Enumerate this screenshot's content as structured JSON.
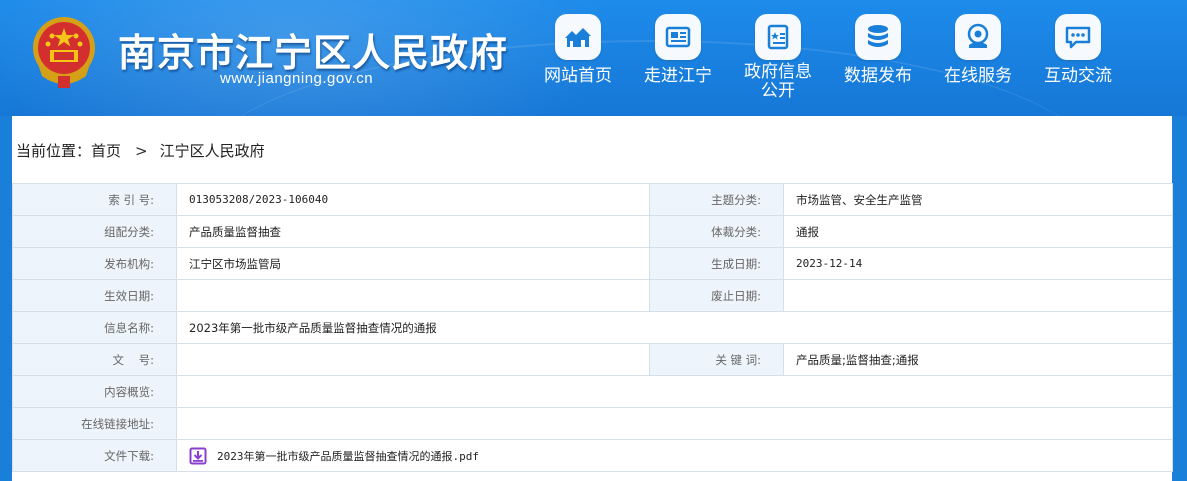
{
  "header": {
    "site_title": "南京市江宁区人民政府",
    "site_url": "www.jiangning.gov.cn",
    "nav": [
      {
        "label": "网站首页",
        "icon": "home-icon"
      },
      {
        "label": "走进江宁",
        "icon": "newspaper-icon"
      },
      {
        "label": "政府信息公开",
        "label_line1": "政府信息",
        "label_line2": "公开",
        "icon": "document-icon"
      },
      {
        "label": "数据发布",
        "icon": "database-icon"
      },
      {
        "label": "在线服务",
        "icon": "service-icon"
      },
      {
        "label": "互动交流",
        "icon": "chat-icon"
      }
    ]
  },
  "breadcrumb": {
    "prefix": "当前位置：",
    "home": "首页",
    "separator": ">",
    "current": "江宁区人民政府"
  },
  "info": {
    "index_label": "索 引 号:",
    "index_value": "013053208/2023-106040",
    "topic_label": "主题分类:",
    "topic_value": "市场监管、安全生产监管",
    "group_label": "组配分类:",
    "group_value": "产品质量监督抽查",
    "genre_label": "体裁分类:",
    "genre_value": "通报",
    "org_label": "发布机构:",
    "org_value": "江宁区市场监管局",
    "created_label": "生成日期:",
    "created_value": "2023-12-14",
    "effective_label": "生效日期:",
    "effective_value": "",
    "repeal_label": "废止日期:",
    "repeal_value": "",
    "name_label": "信息名称:",
    "name_value": "2023年第一批市级产品质量监督抽查情况的通报",
    "docno_label": "文    号:",
    "docno_value": "",
    "keywords_label": "关 键 词:",
    "keywords_value": "产品质量;监督抽查;通报",
    "summary_label": "内容概览:",
    "summary_value": "",
    "link_label": "在线链接地址:",
    "link_value": "",
    "download_label": "文件下载:",
    "download_file": "2023年第一批市级产品质量监督抽查情况的通报.pdf"
  },
  "colors": {
    "header_blue": "#1a7fd8",
    "label_bg": "#eef4fb",
    "icon_purple": "#8a3fd1"
  }
}
